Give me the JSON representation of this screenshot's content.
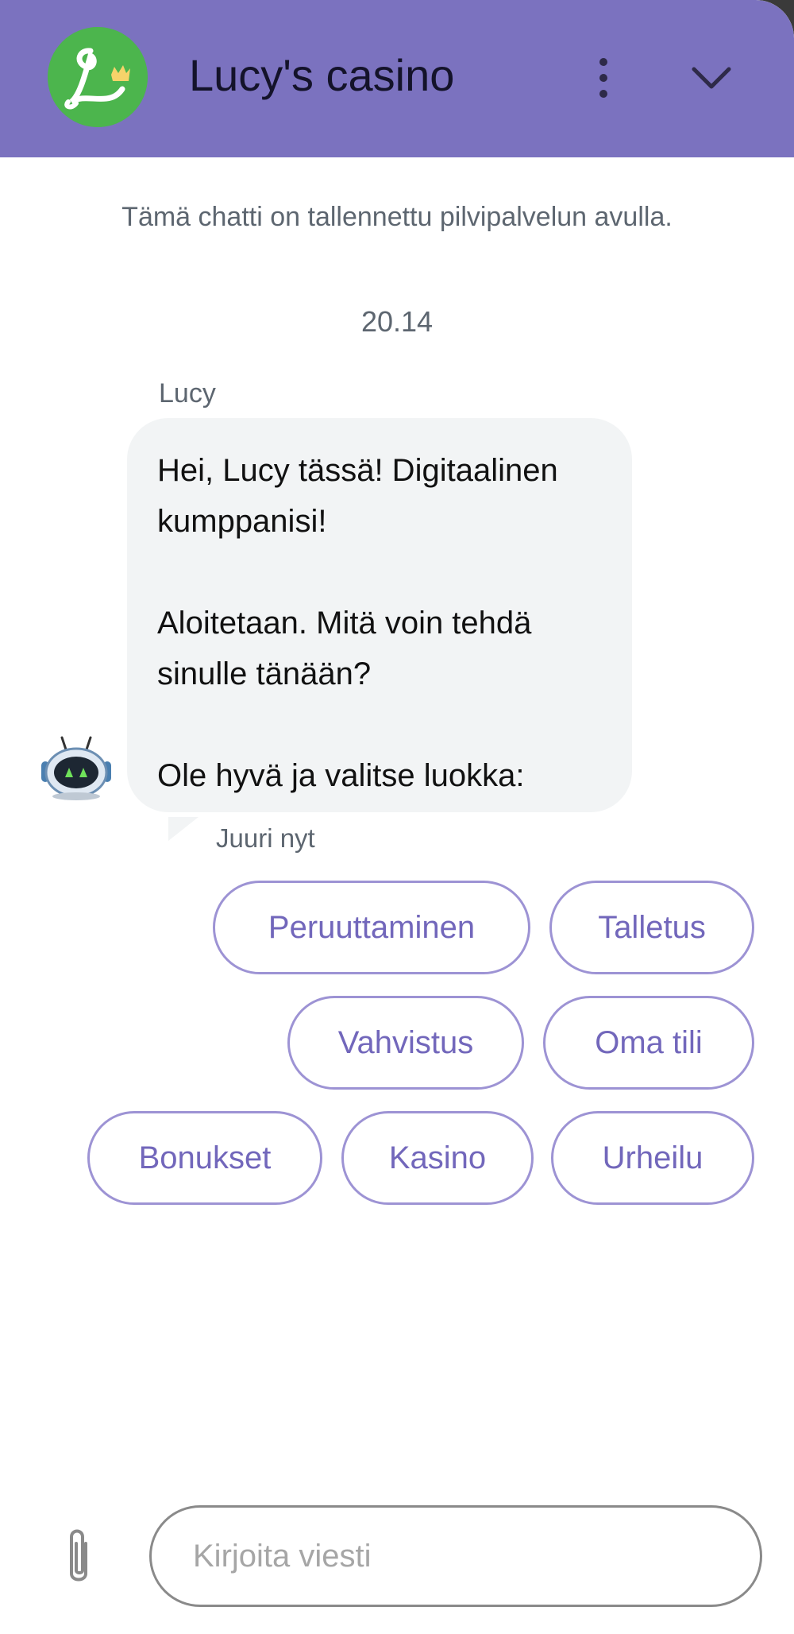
{
  "header": {
    "title": "Lucy's casino",
    "logo_icon": "lucy-logo",
    "menu_icon": "more-vertical-icon",
    "collapse_icon": "chevron-down-icon",
    "background_color": "#7b72bf"
  },
  "chat": {
    "notice": "Tämä chatti on tallennettu pilvipalvelun avulla.",
    "timestamp": "20.14",
    "message": {
      "sender": "Lucy",
      "paragraphs": [
        "Hei, Lucy tässä! Digitaalinen kumppanisi!",
        "Aloitetaan. Mitä voin tehdä sinulle tänään?",
        "Ole hyvä ja valitse luokka:"
      ],
      "time": "Juuri nyt",
      "avatar_icon": "robot-icon"
    },
    "quick_replies": [
      "Peruuttaminen",
      "Talletus",
      "Vahvistus",
      "Oma tili",
      "Bonukset",
      "Kasino",
      "Urheilu"
    ]
  },
  "composer": {
    "placeholder": "Kirjoita viesti",
    "value": "",
    "attach_icon": "paperclip-icon"
  },
  "colors": {
    "accent": "#7b72bf",
    "chip_text": "#7267bb",
    "chip_border": "#9d93d4",
    "bubble_bg": "#f2f4f5"
  }
}
